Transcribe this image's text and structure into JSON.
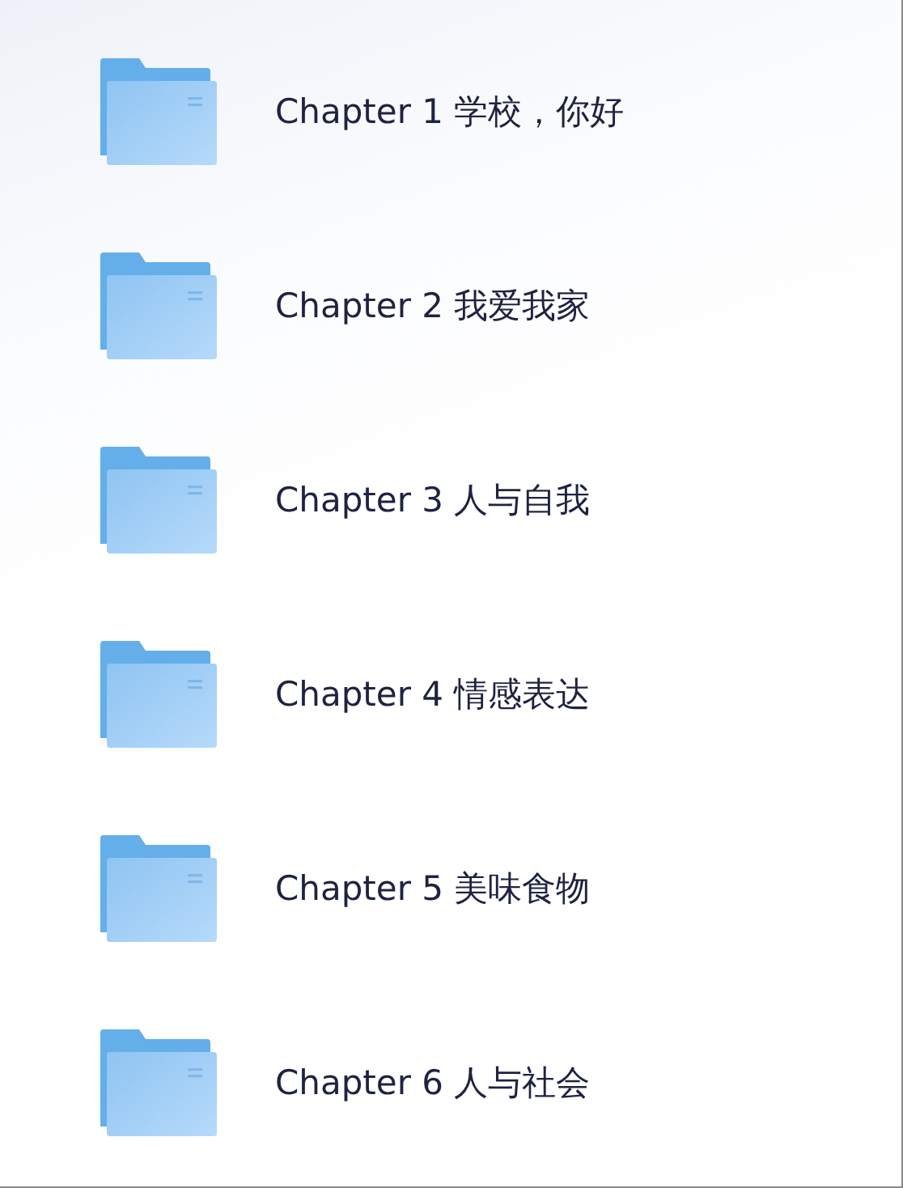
{
  "chapters": [
    {
      "title": "Chapter 1 学校，你好"
    },
    {
      "title": "Chapter 2 我爱我家"
    },
    {
      "title": "Chapter 3 人与自我"
    },
    {
      "title": "Chapter 4 情感表达"
    },
    {
      "title": "Chapter 5 美味食物"
    },
    {
      "title": "Chapter 6 人与社会"
    }
  ]
}
